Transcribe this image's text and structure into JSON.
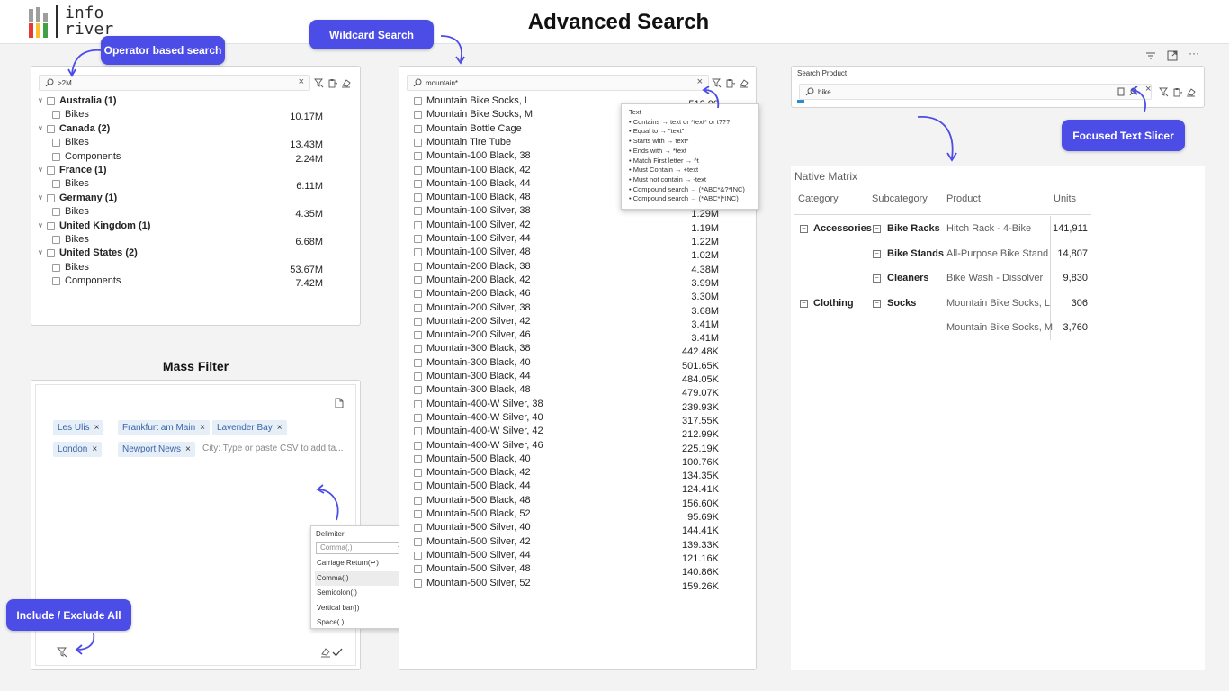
{
  "header": {
    "title": "Advanced Search",
    "logo_top": "info",
    "logo_bottom": "river"
  },
  "callouts": {
    "operator": "Operator based search",
    "wildcard": "Wildcard Search",
    "focused": "Focused Text Slicer",
    "include": "Include / Exclude All"
  },
  "slicer1": {
    "search_value": ">2M",
    "groups": [
      {
        "label": "Australia (1)",
        "children": [
          {
            "label": "Bikes",
            "value": "10.17M"
          }
        ]
      },
      {
        "label": "Canada (2)",
        "children": [
          {
            "label": "Bikes",
            "value": "13.43M"
          },
          {
            "label": "Components",
            "value": "2.24M"
          }
        ]
      },
      {
        "label": "France (1)",
        "children": [
          {
            "label": "Bikes",
            "value": "6.11M"
          }
        ]
      },
      {
        "label": "Germany (1)",
        "children": [
          {
            "label": "Bikes",
            "value": "4.35M"
          }
        ]
      },
      {
        "label": "United Kingdom (1)",
        "children": [
          {
            "label": "Bikes",
            "value": "6.68M"
          }
        ]
      },
      {
        "label": "United States (2)",
        "children": [
          {
            "label": "Bikes",
            "value": "53.67M"
          },
          {
            "label": "Components",
            "value": "7.42M"
          }
        ]
      }
    ]
  },
  "mass_filter": {
    "title": "Mass Filter",
    "tags": [
      "Les Ulis",
      "Frankfurt am Main",
      "Lavender Bay",
      "London",
      "Newport News"
    ],
    "placeholder": "City: Type or paste CSV to add ta...",
    "delimiter": {
      "label": "Delimiter",
      "selected": "Comma(,)",
      "options": [
        "Carriage Return(↵)",
        "Comma(,)",
        "Semicolon(;)",
        "Vertical bar(|)",
        "Space( )"
      ]
    }
  },
  "slicer2": {
    "search_value": "mountain*",
    "items": [
      {
        "label": "Mountain Bike Socks, L",
        "value": "512.00"
      },
      {
        "label": "Mountain Bike Socks, M",
        "value": ""
      },
      {
        "label": "Mountain Bottle Cage",
        "value": ""
      },
      {
        "label": "Mountain Tire Tube",
        "value": ""
      },
      {
        "label": "Mountain-100 Black, 38",
        "value": ""
      },
      {
        "label": "Mountain-100 Black, 42",
        "value": ""
      },
      {
        "label": "Mountain-100 Black, 44",
        "value": ""
      },
      {
        "label": "Mountain-100 Black, 48",
        "value": ""
      },
      {
        "label": "Mountain-100 Silver, 38",
        "value": "1.29M"
      },
      {
        "label": "Mountain-100 Silver, 42",
        "value": "1.19M"
      },
      {
        "label": "Mountain-100 Silver, 44",
        "value": "1.22M"
      },
      {
        "label": "Mountain-100 Silver, 48",
        "value": "1.02M"
      },
      {
        "label": "Mountain-200 Black, 38",
        "value": "4.38M"
      },
      {
        "label": "Mountain-200 Black, 42",
        "value": "3.99M"
      },
      {
        "label": "Mountain-200 Black, 46",
        "value": "3.30M"
      },
      {
        "label": "Mountain-200 Silver, 38",
        "value": "3.68M"
      },
      {
        "label": "Mountain-200 Silver, 42",
        "value": "3.41M"
      },
      {
        "label": "Mountain-200 Silver, 46",
        "value": "3.41M"
      },
      {
        "label": "Mountain-300 Black, 38",
        "value": "442.48K"
      },
      {
        "label": "Mountain-300 Black, 40",
        "value": "501.65K"
      },
      {
        "label": "Mountain-300 Black, 44",
        "value": "484.05K"
      },
      {
        "label": "Mountain-300 Black, 48",
        "value": "479.07K"
      },
      {
        "label": "Mountain-400-W Silver, 38",
        "value": "239.93K"
      },
      {
        "label": "Mountain-400-W Silver, 40",
        "value": "317.55K"
      },
      {
        "label": "Mountain-400-W Silver, 42",
        "value": "212.99K"
      },
      {
        "label": "Mountain-400-W Silver, 46",
        "value": "225.19K"
      },
      {
        "label": "Mountain-500 Black, 40",
        "value": "100.76K"
      },
      {
        "label": "Mountain-500 Black, 42",
        "value": "134.35K"
      },
      {
        "label": "Mountain-500 Black, 44",
        "value": "124.41K"
      },
      {
        "label": "Mountain-500 Black, 48",
        "value": "156.60K"
      },
      {
        "label": "Mountain-500 Black, 52",
        "value": "95.69K"
      },
      {
        "label": "Mountain-500 Silver, 40",
        "value": "144.41K"
      },
      {
        "label": "Mountain-500 Silver, 42",
        "value": "139.33K"
      },
      {
        "label": "Mountain-500 Silver, 44",
        "value": "121.16K"
      },
      {
        "label": "Mountain-500 Silver, 48",
        "value": "140.86K"
      },
      {
        "label": "Mountain-500 Silver, 52",
        "value": "159.26K"
      }
    ],
    "tooltip": {
      "title": "Text",
      "lines": [
        "• Contains → text or *text* or t???",
        "• Equal to → \"text\"",
        "• Starts with → text*",
        "• Ends with → *text",
        "• Match First letter → ^t",
        "• Must Contain → +text",
        "• Must not contain → -text",
        "• Compound search → (*ABC*&?*INC)",
        "• Compound search → (*ABC*|*INC)"
      ]
    }
  },
  "slicer3": {
    "label": "Search Product",
    "search_value": "bike"
  },
  "matrix": {
    "title": "Native Matrix",
    "headers": [
      "Category",
      "Subcategory",
      "Product",
      "Units"
    ],
    "rows": [
      {
        "category": "Accessories",
        "subcategory": "Bike Racks",
        "product": "Hitch Rack - 4-Bike",
        "units": "141,911"
      },
      {
        "category": "",
        "subcategory": "Bike Stands",
        "product": "All-Purpose Bike Stand",
        "units": "14,807"
      },
      {
        "category": "",
        "subcategory": "Cleaners",
        "product": "Bike Wash - Dissolver",
        "units": "9,830"
      },
      {
        "category": "Clothing",
        "subcategory": "Socks",
        "product": "Mountain Bike Socks, L",
        "units": "306"
      },
      {
        "category": "",
        "subcategory": "",
        "product": "Mountain Bike Socks, M",
        "units": "3,760"
      }
    ]
  },
  "colors": {
    "accent": "#4c4ce6",
    "tag_bg": "#e6eef8",
    "tag_text": "#3a66a8",
    "logo_bars": [
      "#9e9e9e",
      "#e53935",
      "#fbc02d",
      "#43a047"
    ]
  }
}
